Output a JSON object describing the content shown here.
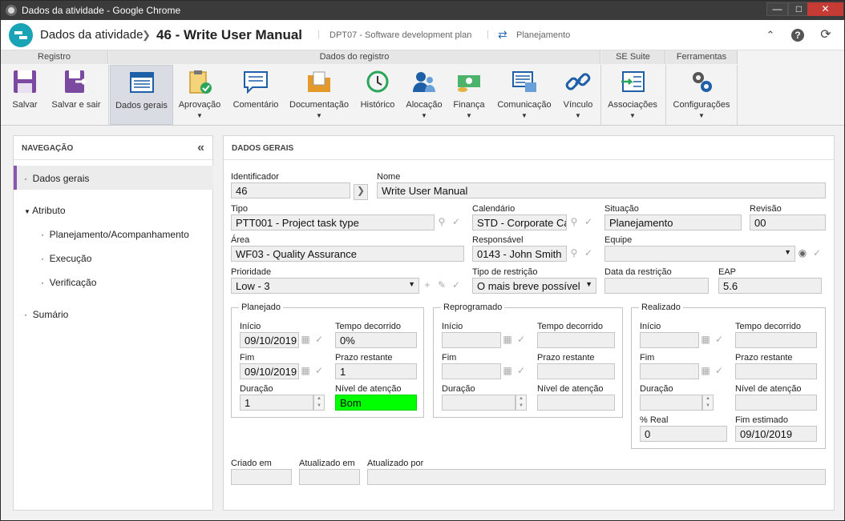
{
  "window": {
    "title": "Dados da atividade - Google Chrome"
  },
  "header": {
    "app": "Dados da atividade",
    "title": "46 - Write User Manual",
    "plan": "DPT07 - Software development plan",
    "status": "Planejamento"
  },
  "ribbon": {
    "groups": {
      "registro": "Registro",
      "dados": "Dados do registro",
      "sesuite": "SE Suite",
      "ferramentas": "Ferramentas"
    },
    "buttons": {
      "salvar": "Salvar",
      "salvar_sair": "Salvar e sair",
      "dados_gerais": "Dados gerais",
      "aprovacao": "Aprovação",
      "comentario": "Comentário",
      "documentacao": "Documentação",
      "historico": "Histórico",
      "alocacao": "Alocação",
      "financa": "Finança",
      "comunicacao": "Comunicação",
      "vinculo": "Vínculo",
      "associacoes": "Associações",
      "configuracoes": "Configurações"
    }
  },
  "nav": {
    "title": "NAVEGAÇÃO",
    "items": {
      "dados_gerais": "Dados gerais",
      "atributo": "Atributo",
      "planejamento": "Planejamento/Acompanhamento",
      "execucao": "Execução",
      "verificacao": "Verificação",
      "sumario": "Sumário"
    }
  },
  "form": {
    "title": "DADOS GERAIS",
    "identificador": {
      "label": "Identificador",
      "value": "46"
    },
    "nome": {
      "label": "Nome",
      "value": "Write User Manual"
    },
    "tipo": {
      "label": "Tipo",
      "value": "PTT001 - Project task type"
    },
    "calendario": {
      "label": "Calendário",
      "value": "STD - Corporate Ca"
    },
    "situacao": {
      "label": "Situação",
      "value": "Planejamento"
    },
    "revisao": {
      "label": "Revisão",
      "value": "00"
    },
    "area": {
      "label": "Área",
      "value": "WF03 - Quality Assurance"
    },
    "responsavel": {
      "label": "Responsável",
      "value": "0143 - John Smith"
    },
    "equipe": {
      "label": "Equipe",
      "value": ""
    },
    "prioridade": {
      "label": "Prioridade",
      "value": "Low - 3"
    },
    "tipo_restricao": {
      "label": "Tipo de restrição",
      "value": "O mais breve possível"
    },
    "data_restricao": {
      "label": "Data da restrição",
      "value": ""
    },
    "eap": {
      "label": "EAP",
      "value": "5.6"
    },
    "planejado": {
      "title": "Planejado",
      "inicio_label": "Início",
      "inicio": "09/10/2019",
      "tempo_label": "Tempo decorrido",
      "tempo": "0%",
      "fim_label": "Fim",
      "fim": "09/10/2019",
      "prazo_label": "Prazo restante",
      "prazo": "1",
      "duracao_label": "Duração",
      "duracao": "1",
      "nivel_label": "Nível de atenção",
      "nivel": "Bom"
    },
    "reprogramado": {
      "title": "Reprogramado",
      "inicio_label": "Início",
      "tempo_label": "Tempo decorrido",
      "fim_label": "Fim",
      "prazo_label": "Prazo restante",
      "duracao_label": "Duração",
      "nivel_label": "Nível de atenção"
    },
    "realizado": {
      "title": "Realizado",
      "inicio_label": "Início",
      "tempo_label": "Tempo decorrido",
      "fim_label": "Fim",
      "prazo_label": "Prazo restante",
      "duracao_label": "Duração",
      "nivel_label": "Nível de atenção",
      "real_label": "% Real",
      "real": "0",
      "fim_est_label": "Fim estimado",
      "fim_est": "09/10/2019"
    },
    "criado_em": {
      "label": "Criado em",
      "value": ""
    },
    "atualizado_em": {
      "label": "Atualizado em",
      "value": ""
    },
    "atualizado_por": {
      "label": "Atualizado por",
      "value": ""
    }
  },
  "colors": {
    "accent": "#8a56ac",
    "good": "#00ff00",
    "brand": "#1aa3b5"
  }
}
